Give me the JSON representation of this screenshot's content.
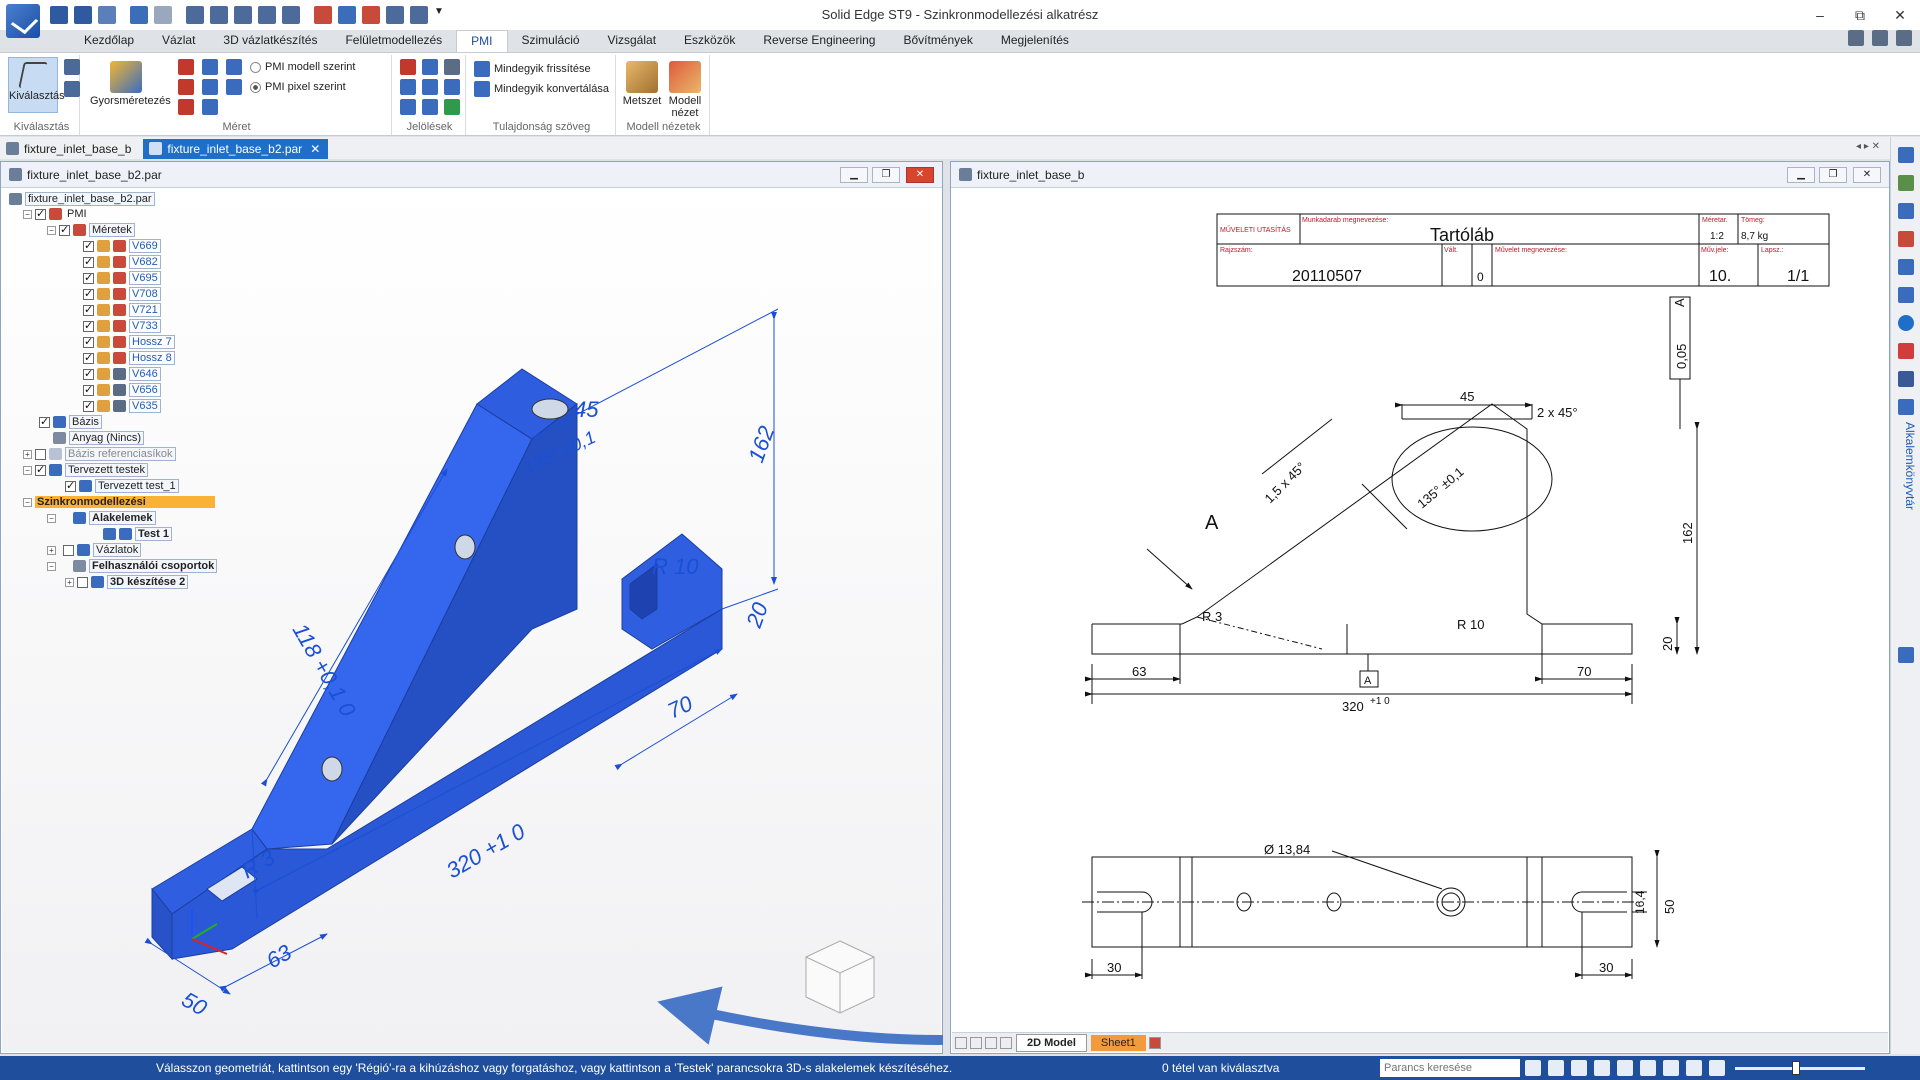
{
  "app": {
    "title": "Solid Edge ST9 - Szinkronmodellezési alkatrész"
  },
  "window_controls": [
    "–",
    "⧉",
    "✕"
  ],
  "menu_tabs": [
    "Kezdőlap",
    "Vázlat",
    "3D vázlatkészítés",
    "Felületmodellezés",
    "PMI",
    "Szimuláció",
    "Vizsgálat",
    "Eszközök",
    "Reverse Engineering",
    "Bővítmények",
    "Megjelenítés"
  ],
  "ribbon": {
    "select_label": "Kiválasztás",
    "select_group": "Kiválasztás",
    "quickdim_label": "Gyorsméretezés",
    "dim_group": "Méret",
    "pmi_model": "PMI modell szerint",
    "pmi_pixel": "PMI pixel szerint",
    "annot_group": "Jelölések",
    "refresh_all": "Mindegyik frissítése",
    "convert_all": "Mindegyik konvertálása",
    "propertext_group": "Tulajdonság szöveg",
    "section_label": "Metszet",
    "modelview_label": "Modell nézet",
    "modelview_group": "Modell nézetek"
  },
  "doc_tabs": [
    "fixture_inlet_base_b",
    "fixture_inlet_base_b2.par"
  ],
  "left_pane": {
    "title": "fixture_inlet_base_b2.par",
    "tree": {
      "root": "fixture_inlet_base_b2.par",
      "pmi": "PMI",
      "dims": "Méretek",
      "dim_items": [
        "V669",
        "V682",
        "V695",
        "V708",
        "V721",
        "V733",
        "Hossz 7",
        "Hossz 8",
        "V646",
        "V656",
        "V635"
      ],
      "base": "Bázis",
      "material": "Anyag (Nincs)",
      "ref_planes": "Bázis referenciasíkok",
      "designed_bodies": "Tervezett testek",
      "designed_body_1": "Tervezett test_1",
      "sync": "Szinkronmodellezési",
      "features": "Alakelemek",
      "body1": "Test 1",
      "sketches": "Vázlatok",
      "user_groups": "Felhasználói csoportok",
      "make3d": "3D készítése 2"
    },
    "model_dims": [
      "45",
      "162",
      "135° ±0,1",
      "R 10",
      "20",
      "118 +0,1 0",
      "70",
      "320 +1 0",
      "R 3",
      "63",
      "50"
    ]
  },
  "right_pane": {
    "title": "fixture_inlet_base_b",
    "titleblock": {
      "doc_type": "MŰVELETI UTASÍTÁS",
      "part_name_label": "Munkadarab megnevezése:",
      "part_name": "Tartóláb",
      "scale_label": "Méretar.",
      "scale": "1:2",
      "mass_label": "Tömeg:",
      "mass": "8,7 kg",
      "drawing_no_label": "Rajzszám:",
      "drawing_no": "20110507",
      "rev_label": "Vált.",
      "rev": "0",
      "op_name_label": "Művelet megnevezése:",
      "op_no_label": "Műv.jele:",
      "op_no": "10.",
      "sheet_label": "Lapsz.:",
      "sheet": "1/1"
    },
    "dims": {
      "d45": "45",
      "chamfer": "2 x 45°",
      "tol": "0,05",
      "datumA": "A",
      "chamfer2": "1,5 x 45°",
      "angle": "135° ±0,1",
      "d162": "162",
      "r3": "R 3",
      "r10": "R 10",
      "d20": "20",
      "d63": "63",
      "d70": "70",
      "d320": "320",
      "tol320": "+1 0",
      "dia": "Ø 13,84",
      "d16": "16,4",
      "d50": "50",
      "d30a": "30",
      "d30b": "30"
    },
    "sheet_tabs": [
      "2D Model",
      "Sheet1"
    ]
  },
  "right_bar": {
    "label": "Alkalemkönyvtár"
  },
  "status": {
    "prompt": "Válasszon geometriát, kattintson egy 'Régió'-ra a kihúzáshoz vagy forgatáshoz, vagy kattintson a 'Testek' parancsokra 3D-s alakelemek készítéséhez.",
    "selection": "0 tétel van kiválasztva",
    "command_search": "Parancs keresése"
  },
  "colors": {
    "accent": "#1f4e9c",
    "model_blue": "#2f5fe0",
    "dim_blue": "#1a4fd6",
    "arrow": "#4a78c8"
  }
}
